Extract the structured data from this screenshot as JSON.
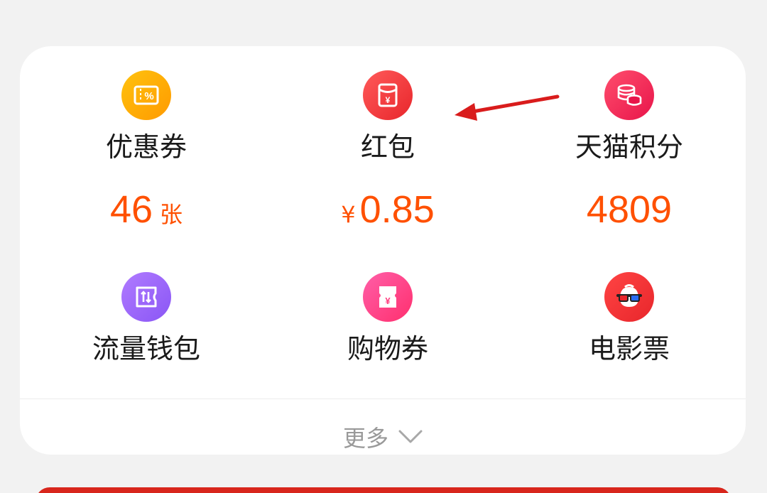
{
  "grid": {
    "items": [
      {
        "label": "优惠券",
        "value": "46",
        "unit": "张",
        "icon": "coupon-percent-icon",
        "color_start": "#ffc20e",
        "color_end": "#ff9a00"
      },
      {
        "label": "红包",
        "prefix": "¥",
        "value": "0.85",
        "icon": "red-envelope-icon",
        "color_start": "#ff5a5a",
        "color_end": "#e8262b"
      },
      {
        "label": "天猫积分",
        "value": "4809",
        "icon": "coin-stack-icon",
        "color_start": "#ff4d6d",
        "color_end": "#e8154a"
      },
      {
        "label": "流量钱包",
        "icon": "data-wallet-icon",
        "color_start": "#b07bff",
        "color_end": "#8a56f5"
      },
      {
        "label": "购物券",
        "icon": "shopping-voucher-icon",
        "color_start": "#ff5fa8",
        "color_end": "#ff2f6e"
      },
      {
        "label": "电影票",
        "icon": "movie-ticket-3d-glasses-icon",
        "color_start": "#ff4444",
        "color_end": "#e8262b"
      }
    ]
  },
  "more": {
    "label": "更多"
  },
  "colors": {
    "value_orange": "#ff5000",
    "annotation_arrow": "#d91c1c"
  }
}
